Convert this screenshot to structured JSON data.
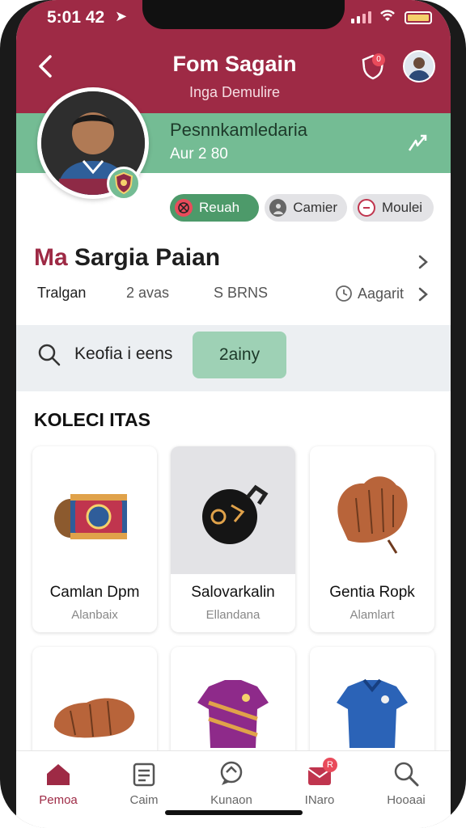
{
  "status_bar": {
    "time": "5:01 42"
  },
  "header": {
    "title": "Fom Sagain",
    "subtitle": "Inga Demulire",
    "notification_count": "0"
  },
  "profile": {
    "band_title": "Pesnnkamledaria",
    "band_subtitle": "Aur 2 80",
    "chips": [
      {
        "label": "Reuah",
        "icon": "basketball-icon"
      },
      {
        "label": "Camier",
        "icon": "person-icon"
      },
      {
        "label": "Moulei",
        "icon": "no-entry-icon"
      }
    ],
    "name_prefix": "Ma",
    "name_main": "Sargia Paian",
    "stats": [
      "Tralgan",
      "2 avas",
      "S BRNS",
      "Aagarit"
    ]
  },
  "search": {
    "placeholder": "Keofia i eens",
    "pill": "2ainy"
  },
  "collection": {
    "title": "KOLECI ITAS",
    "items": [
      {
        "title": "Camlan Dpm",
        "sub": "Alanbaix",
        "icon": "drum-icon"
      },
      {
        "title": "Salovarkalin",
        "sub": "Ellandana",
        "icon": "bell-icon"
      },
      {
        "title": "Gentia Ropk",
        "sub": "Alamlart",
        "icon": "glove-icon"
      },
      {
        "title": "",
        "sub": "",
        "icon": "leather-glove-icon"
      },
      {
        "title": "",
        "sub": "",
        "icon": "purple-jersey-icon"
      },
      {
        "title": "",
        "sub": "",
        "icon": "blue-jersey-icon"
      }
    ]
  },
  "tabbar": [
    {
      "label": "Pemoa",
      "icon": "home-icon",
      "active": true
    },
    {
      "label": "Caim",
      "icon": "list-icon",
      "active": false
    },
    {
      "label": "Kunaon",
      "icon": "chat-icon",
      "active": false
    },
    {
      "label": "INaro",
      "icon": "mail-icon",
      "active": false,
      "badge": "R"
    },
    {
      "label": "Hooaai",
      "icon": "search-icon",
      "active": false
    }
  ],
  "colors": {
    "brand": "#9e2a45",
    "accent": "#74bc94",
    "accent_dark": "#4d9a6a"
  }
}
